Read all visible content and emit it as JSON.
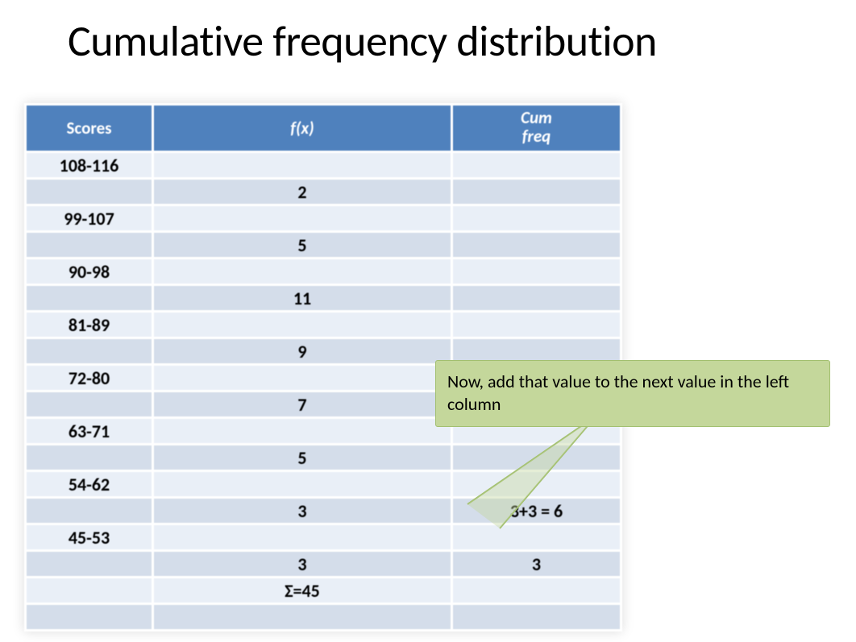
{
  "title": "Cumulative frequency distribution",
  "table": {
    "headers": {
      "scores": "Scores",
      "fx": "f(x)",
      "cum": "Cum freq"
    },
    "rows": [
      {
        "score": "108-116",
        "fx": "2",
        "cum": ""
      },
      {
        "score": "99-107",
        "fx": "5",
        "cum": ""
      },
      {
        "score": "90-98",
        "fx": "11",
        "cum": ""
      },
      {
        "score": "81-89",
        "fx": "9",
        "cum": ""
      },
      {
        "score": "72-80",
        "fx": "7",
        "cum": ""
      },
      {
        "score": "63-71",
        "fx": "5",
        "cum": ""
      },
      {
        "score": "54-62",
        "fx": "3",
        "cum": "3+3 = 6"
      },
      {
        "score": "45-53",
        "fx": "3",
        "cum": "3"
      }
    ],
    "sigma_label": "Σ=45"
  },
  "callout": {
    "text": "Now, add that value to the next value in the left column"
  },
  "chart_data": {
    "type": "table",
    "title": "Cumulative frequency distribution",
    "columns": [
      "Scores",
      "f(x)",
      "Cum freq"
    ],
    "rows": [
      [
        "108-116",
        2,
        null
      ],
      [
        "99-107",
        5,
        null
      ],
      [
        "90-98",
        11,
        null
      ],
      [
        "81-89",
        9,
        null
      ],
      [
        "72-80",
        7,
        null
      ],
      [
        "63-71",
        5,
        null
      ],
      [
        "54-62",
        3,
        6
      ],
      [
        "45-53",
        3,
        3
      ]
    ],
    "sigma_fx": 45,
    "annotation": "Now, add that value to the next value in the left column"
  }
}
